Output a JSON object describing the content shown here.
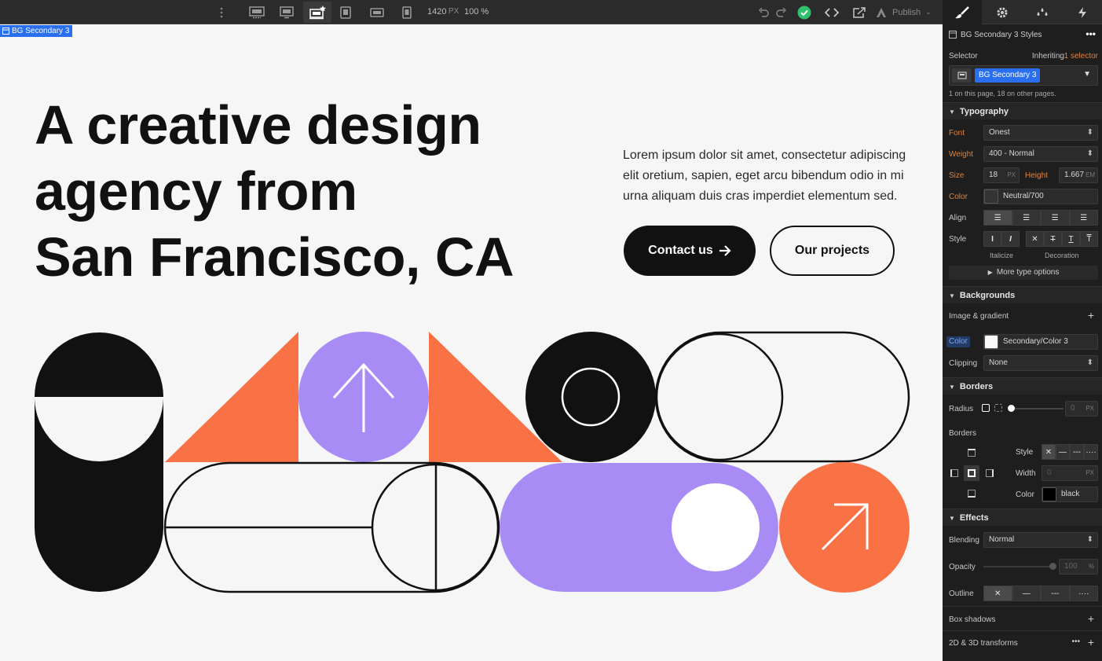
{
  "toolbar": {
    "width_value": "1420",
    "width_unit": "PX",
    "zoom": "100 %",
    "publish_label": "Publish",
    "breakpoints": [
      "desktop-large-icon",
      "desktop-medium-icon",
      "desktop-base-icon",
      "tablet-icon",
      "mobile-landscape-icon",
      "mobile-portrait-icon"
    ],
    "status_color": "#2fc16b"
  },
  "panel_tabs": [
    "style-brush-icon",
    "settings-gear-icon",
    "interactions-drops-icon",
    "lightning-icon"
  ],
  "canvas": {
    "selected_label": "BG Secondary 3",
    "hero": {
      "title_lines": [
        "A creative design",
        "agency from",
        "San Francisco, CA"
      ],
      "body": "Lorem ipsum dolor sit amet, consectetur adipiscing elit oretium, sapien, eget arcu bibendum odio in mi urna aliquam duis cras imperdiet elementum sed.",
      "primary_button": "Contact us",
      "secondary_button": "Our projects"
    },
    "colors": {
      "orange": "#f97245",
      "purple": "#a98bf5",
      "black": "#111111",
      "background": "#f6f6f6"
    }
  },
  "panel": {
    "header_title": "BG Secondary 3 Styles",
    "selector_label": "Selector",
    "inheriting_prefix": "Inheriting",
    "inheriting_count": "1 selector",
    "selector_chip": "BG Secondary 3",
    "selector_note": "1 on this page, 18 on other pages.",
    "typography": {
      "title": "Typography",
      "font_label": "Font",
      "font_value": "Onest",
      "weight_label": "Weight",
      "weight_value": "400 - Normal",
      "size_label": "Size",
      "size_value": "18",
      "size_unit": "PX",
      "height_label": "Height",
      "height_value": "1.667",
      "height_unit": "EM",
      "color_label": "Color",
      "color_value": "Neutral/700",
      "align_label": "Align",
      "style_label": "Style",
      "italicize_caption": "Italicize",
      "decoration_caption": "Decoration",
      "more_options": "More type options"
    },
    "backgrounds": {
      "title": "Backgrounds",
      "image_gradient": "Image & gradient",
      "color_label": "Color",
      "color_value": "Secondary/Color 3",
      "clipping_label": "Clipping",
      "clipping_value": "None"
    },
    "borders": {
      "title": "Borders",
      "radius_label": "Radius",
      "radius_value": "0",
      "radius_unit": "PX",
      "borders_label": "Borders",
      "style_label": "Style",
      "width_label": "Width",
      "width_value": "0",
      "width_unit": "PX",
      "color_label": "Color",
      "color_value": "black"
    },
    "effects": {
      "title": "Effects",
      "blending_label": "Blending",
      "blending_value": "Normal",
      "opacity_label": "Opacity",
      "opacity_value": "100",
      "opacity_unit": "%",
      "outline_label": "Outline",
      "box_shadows": "Box shadows",
      "transforms": "2D & 3D transforms"
    }
  }
}
